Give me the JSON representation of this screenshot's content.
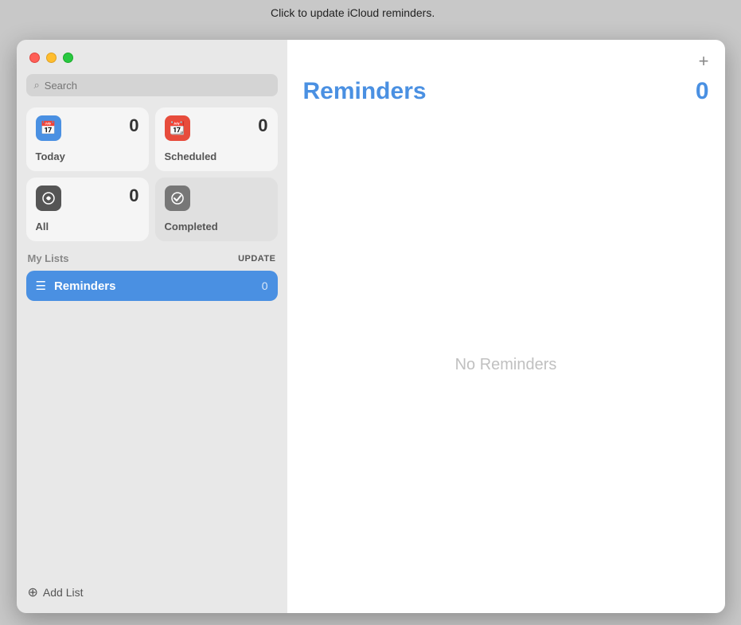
{
  "tooltip": "Click to update iCloud reminders.",
  "sidebar": {
    "search": {
      "placeholder": "Search",
      "icon": "🔍"
    },
    "smart_lists": [
      {
        "id": "today",
        "label": "Today",
        "count": "0",
        "icon_type": "today",
        "icon_glyph": "📅"
      },
      {
        "id": "scheduled",
        "label": "Scheduled",
        "count": "0",
        "icon_type": "scheduled",
        "icon_glyph": "📆"
      },
      {
        "id": "all",
        "label": "All",
        "count": "0",
        "icon_type": "all",
        "icon_glyph": "☁"
      },
      {
        "id": "completed",
        "label": "Completed",
        "count": "",
        "icon_type": "completed",
        "icon_glyph": "✓"
      }
    ],
    "my_lists_label": "My Lists",
    "update_label": "UPDATE",
    "lists": [
      {
        "id": "reminders",
        "label": "Reminders",
        "count": "0"
      }
    ],
    "add_list_label": "Add List"
  },
  "main": {
    "title": "Reminders",
    "count": "0",
    "empty_state": "No Reminders",
    "add_button_label": "+"
  },
  "colors": {
    "accent": "#4a90e2",
    "today_bg": "#4a90e2",
    "scheduled_bg": "#e74c3c",
    "all_bg": "#555",
    "completed_bg": "#777"
  }
}
